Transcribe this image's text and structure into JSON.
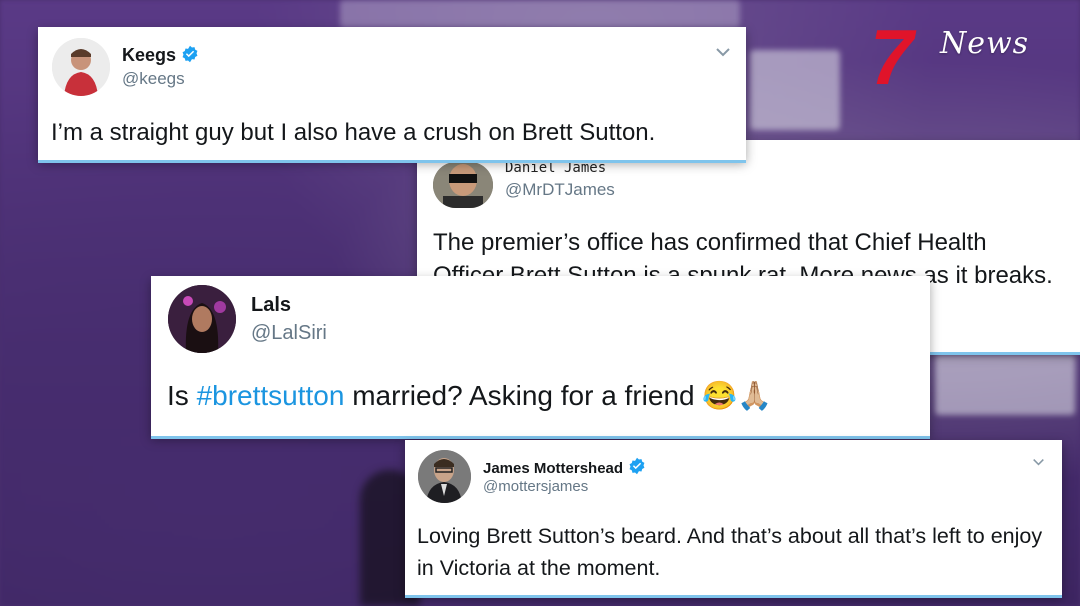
{
  "brand": {
    "logo_text": "News",
    "logo_icon": "seven-logo-icon"
  },
  "colors": {
    "link": "#1b95e0",
    "verified": "#1da1f2",
    "accent_shadow": "#7fc4ec"
  },
  "tweets": [
    {
      "name": "Keegs",
      "handle": "@keegs",
      "verified": true,
      "text": "I’m a straight guy but I also have a crush on Brett Sutton."
    },
    {
      "name": "Daniel James",
      "handle": "@MrDTJames",
      "verified": false,
      "text": "The premier’s office has confirmed that Chief Health Officer Brett Sutton is a spunk rat. More news as it breaks."
    },
    {
      "name": "Lals",
      "handle": "@LalSiri",
      "verified": false,
      "text_before": "Is ",
      "hashtag": "#brettsutton",
      "text_after": " married? Asking for a friend ",
      "emoji": "😂🙏🏼"
    },
    {
      "name": "James Mottershead",
      "handle": "@mottersjames",
      "verified": true,
      "text": "Loving Brett Sutton’s beard. And that’s about all that’s left to enjoy in Victoria at the moment."
    }
  ]
}
